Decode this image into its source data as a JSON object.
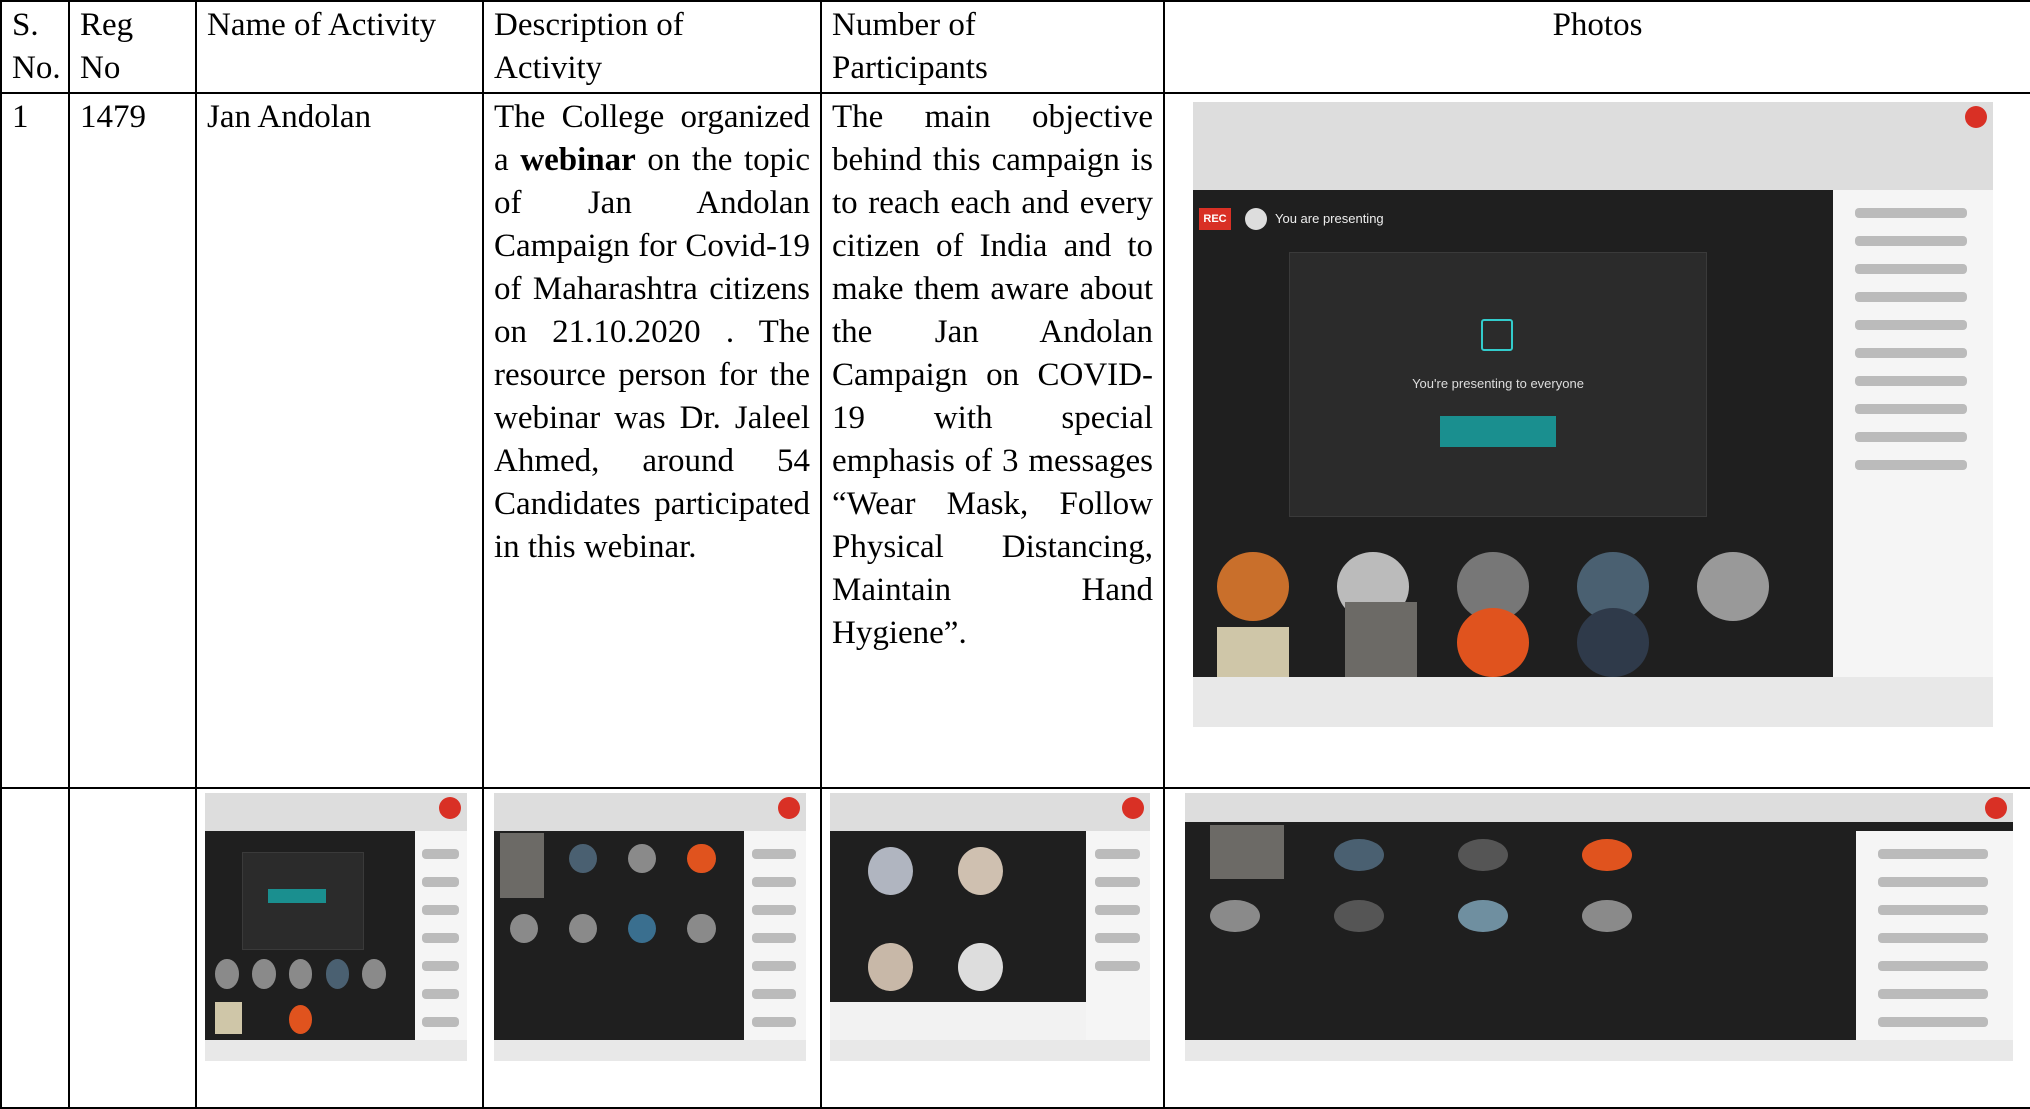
{
  "table": {
    "headers": {
      "sno": [
        "S.",
        "No."
      ],
      "regno": [
        "Reg",
        "No"
      ],
      "name": "Name of Activity",
      "description": [
        "Description of",
        "Activity"
      ],
      "participants": [
        "Number of",
        "Participants"
      ],
      "photos": "Photos"
    },
    "row1": {
      "sno": "1",
      "regno": "1479",
      "name": "Jan Andolan",
      "description": {
        "part1": "The College organized a ",
        "bold": "webinar",
        "part2": " on the topic of Jan Andolan Campaign for Covid-19 of Maharashtra citizens on 21.10.2020 . The resource person for the webinar was Dr. Jaleel Ahmed, around 54 Candidates participated in this webinar."
      },
      "participants": "The main objective behind this campaign is to reach each and every citizen of India and to make them aware about the Jan Andolan Campaign on COVID-19 with special emphasis of 3 messages “Wear Mask, Follow Physical Distancing, Maintain Hand Hygiene”."
    },
    "photo_main": {
      "recording_badge": "REC",
      "banner": "You are presenting",
      "center_text": "You're presenting to everyone"
    }
  }
}
